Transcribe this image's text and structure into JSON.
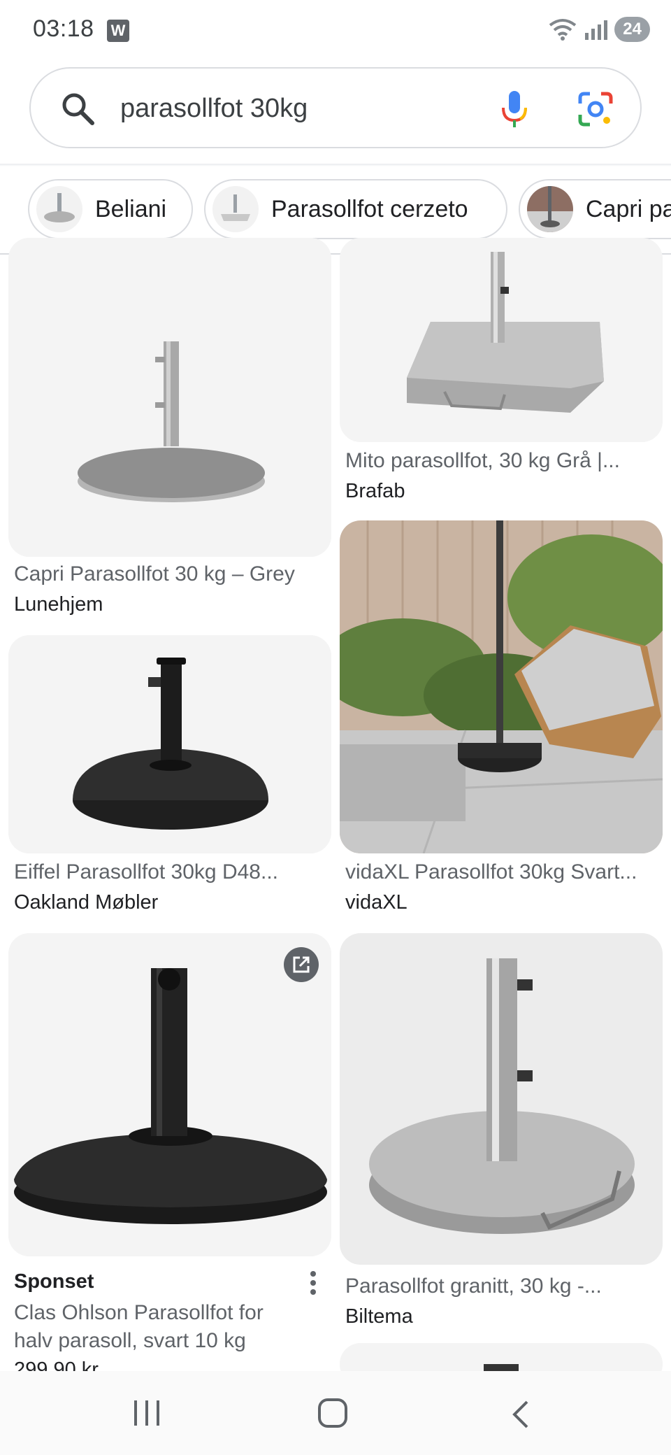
{
  "status": {
    "time": "03:18",
    "app_badge": "W",
    "battery": "24"
  },
  "search": {
    "query": "parasollfot 30kg"
  },
  "chips": [
    {
      "label": "Beliani"
    },
    {
      "label": "Parasollfot cerzeto"
    },
    {
      "label": "Capri pa"
    }
  ],
  "results": [
    {
      "title": "Capri Parasollfot 30 kg – Grey",
      "source": "Lunehjem"
    },
    {
      "title": "Mito parasollfot, 30 kg Grå |...",
      "source": "Brafab"
    },
    {
      "title": "Eiffel Parasollfot 30kg D48...",
      "source": "Oakland Møbler"
    },
    {
      "title": "vidaXL Parasollfot 30kg Svart...",
      "source": "vidaXL"
    },
    {
      "sponsored": "Sponset",
      "title_line1": "Clas Ohlson Parasollfot for",
      "title_line2": "halv parasoll, svart 10 kg",
      "price": "299,90 kr"
    },
    {
      "title": "Parasollfot granitt, 30 kg -...",
      "source": "Biltema"
    }
  ],
  "icons": {
    "search": "search-icon",
    "mic": "mic-icon",
    "lens": "lens-icon",
    "open": "open-in-new-icon",
    "more": "more-vert-icon",
    "recents": "recents-icon",
    "home": "home-icon",
    "back": "back-icon"
  },
  "colors": {
    "mic_blue": "#4285f4",
    "mic_red": "#ea4335",
    "mic_yellow": "#fbbc04",
    "mic_green": "#34a853"
  }
}
